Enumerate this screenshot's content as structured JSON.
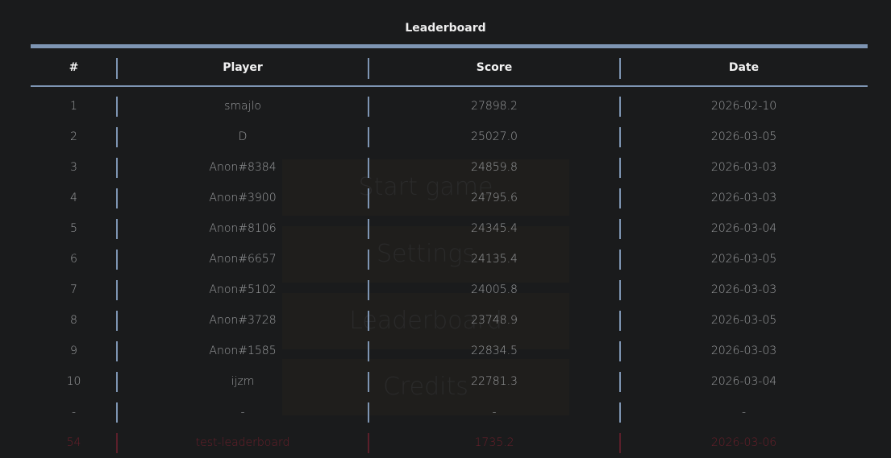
{
  "menu": {
    "start_label": "Start game",
    "settings_label": "Settings",
    "leaderboard_label": "Leaderboard",
    "credits_label": "Credits"
  },
  "leaderboard": {
    "title": "Leaderboard",
    "columns": {
      "rank": "#",
      "player": "Player",
      "score": "Score",
      "date": "Date"
    },
    "rows": [
      {
        "rank": "1",
        "player": "smajlo",
        "score": "27898.2",
        "date": "2026-02-10"
      },
      {
        "rank": "2",
        "player": "D",
        "score": "25027.0",
        "date": "2026-03-05"
      },
      {
        "rank": "3",
        "player": "Anon#8384",
        "score": "24859.8",
        "date": "2026-03-03"
      },
      {
        "rank": "4",
        "player": "Anon#3900",
        "score": "24795.6",
        "date": "2026-03-03"
      },
      {
        "rank": "5",
        "player": "Anon#8106",
        "score": "24345.4",
        "date": "2026-03-04"
      },
      {
        "rank": "6",
        "player": "Anon#6657",
        "score": "24135.4",
        "date": "2026-03-05"
      },
      {
        "rank": "7",
        "player": "Anon#5102",
        "score": "24005.8",
        "date": "2026-03-03"
      },
      {
        "rank": "8",
        "player": "Anon#3728",
        "score": "23748.9",
        "date": "2026-03-05"
      },
      {
        "rank": "9",
        "player": "Anon#1585",
        "score": "22834.5",
        "date": "2026-03-03"
      },
      {
        "rank": "10",
        "player": "ijzm",
        "score": "22781.3",
        "date": "2026-03-04"
      },
      {
        "rank": "-",
        "player": "-",
        "score": "-",
        "date": "-"
      }
    ],
    "self_row": {
      "rank": "54",
      "player": "test-leaderboard",
      "score": "1735.2",
      "date": "2026-03-06"
    }
  },
  "colors": {
    "accent": "#7e95b3",
    "background": "#1a1b1c",
    "self_highlight": "#6a1f2a"
  }
}
